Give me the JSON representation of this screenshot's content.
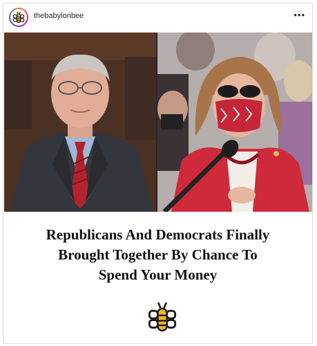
{
  "post": {
    "username": "thebabylonbee",
    "more_label": "•••"
  },
  "headline": {
    "line1": "Republicans And Democrats Finally",
    "line2": "Brought Together By Chance To",
    "line3": "Spend Your Money"
  },
  "colors": {
    "bee_yellow": "#f2b51f",
    "bee_dark": "#1a1a1a",
    "jacket_red": "#cf2a3b"
  },
  "icons": {
    "avatar": "babylon-bee-logo-icon",
    "more": "more-options-icon",
    "footer_logo": "babylon-bee-logo-icon"
  }
}
